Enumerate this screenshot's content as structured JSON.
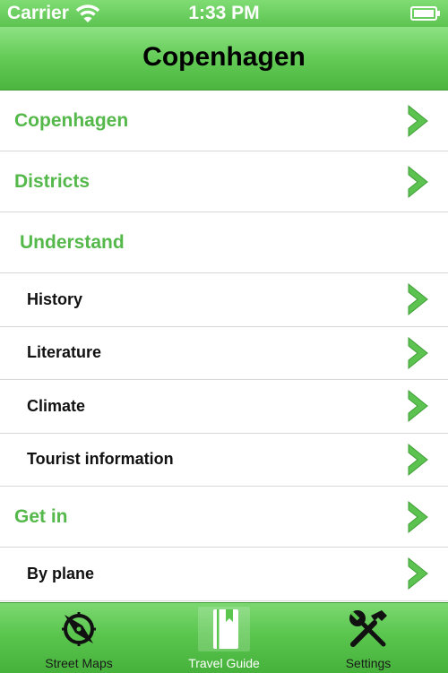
{
  "status_bar": {
    "carrier": "Carrier",
    "time": "1:33 PM"
  },
  "nav": {
    "title": "Copenhagen"
  },
  "rows": [
    {
      "label": "Copenhagen",
      "kind": "section",
      "has_chevron": true
    },
    {
      "label": "Districts",
      "kind": "section",
      "has_chevron": true
    },
    {
      "label": "Understand",
      "kind": "section",
      "has_chevron": false
    },
    {
      "label": "History",
      "kind": "sub",
      "has_chevron": true
    },
    {
      "label": "Literature",
      "kind": "sub",
      "has_chevron": true
    },
    {
      "label": "Climate",
      "kind": "sub",
      "has_chevron": true
    },
    {
      "label": "Tourist information",
      "kind": "sub",
      "has_chevron": true
    },
    {
      "label": "Get in",
      "kind": "section",
      "has_chevron": true
    },
    {
      "label": "By plane",
      "kind": "sub",
      "has_chevron": true
    }
  ],
  "tabs": [
    {
      "label": "Street Maps",
      "icon": "compass-icon",
      "active": false
    },
    {
      "label": "Travel Guide",
      "icon": "book-icon",
      "active": true
    },
    {
      "label": "Settings",
      "icon": "tools-icon",
      "active": false
    }
  ],
  "colors": {
    "accent_green": "#54b84a",
    "bar_green": "#5ac64e",
    "chevron_green": "#5cc350"
  }
}
